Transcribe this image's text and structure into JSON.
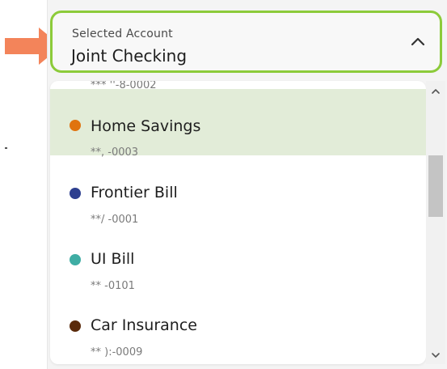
{
  "accent": "#8ccb3a",
  "selected_row_bg": "#e2ecd8",
  "arrow_color": "#f3845a",
  "select": {
    "label": "Selected Account",
    "value": "Joint Checking",
    "icon": "chevron-up-icon"
  },
  "accounts": {
    "partial_top_number": "*** ''-8-0002",
    "items": [
      {
        "name": "Home Savings",
        "number": "**,    -0003",
        "dot_color": "#e0730e",
        "selected": true
      },
      {
        "name": "Frontier Bill",
        "number": "**/      -0001",
        "dot_color": "#2d3f8f",
        "selected": false
      },
      {
        "name": "UI Bill",
        "number": "**        -0101",
        "dot_color": "#3fada4",
        "selected": false
      },
      {
        "name": "Car Insurance",
        "number": "**    ):-0009",
        "dot_color": "#5a2a0b",
        "selected": false
      }
    ]
  },
  "scrollbar": {
    "up_icon": "chevron-up-icon",
    "down_icon": "chevron-down-icon"
  }
}
